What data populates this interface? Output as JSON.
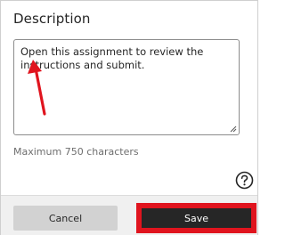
{
  "description": {
    "heading": "Description",
    "text": "Open this assignment to review the instructions and submit.",
    "helper": "Maximum 750 characters"
  },
  "icons": {
    "help": "question-circle-icon",
    "resize": "resize-grip-icon",
    "annotation": "red-arrow-annotation"
  },
  "footer": {
    "cancel_label": "Cancel",
    "save_label": "Save"
  },
  "colors": {
    "highlight": "#e0141e",
    "primary_button": "#262626",
    "secondary_button": "#d2d2d2"
  }
}
